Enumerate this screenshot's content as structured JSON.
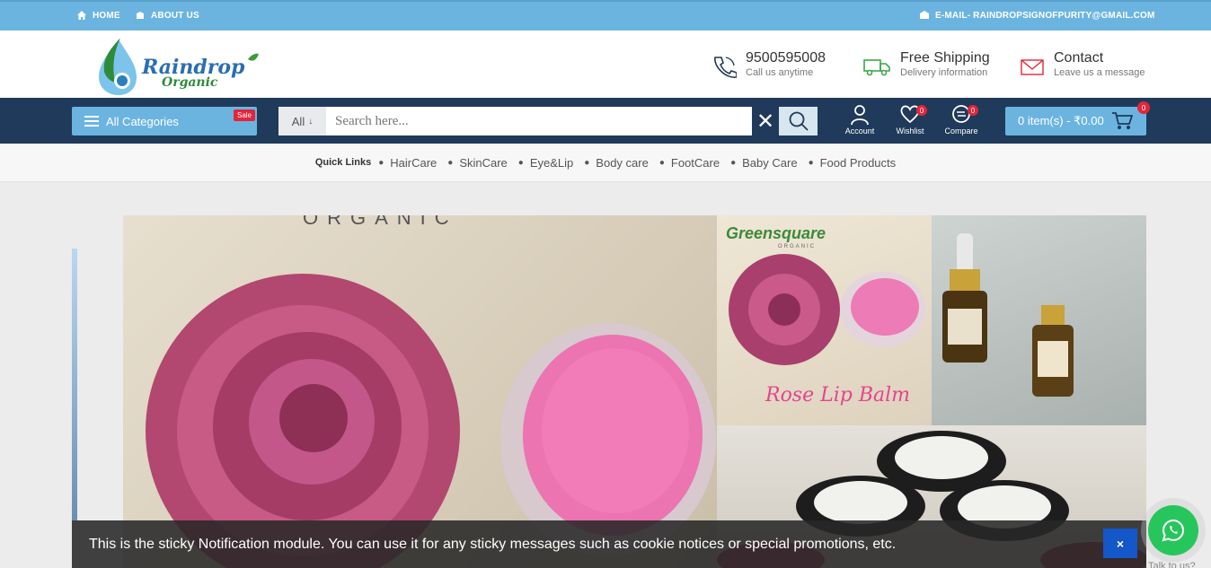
{
  "topbar": {
    "home": "HOME",
    "about": "ABOUT US",
    "email": "E-MAIL- RAINDROPSIGNOFPURITY@GMAIL.COM"
  },
  "header": {
    "logo_text_1": "Raindrop",
    "logo_text_2": "Organic",
    "phone": {
      "main": "9500595008",
      "sub": "Call us anytime"
    },
    "shipping": {
      "main": "Free Shipping",
      "sub": "Delivery information"
    },
    "contact": {
      "main": "Contact",
      "sub": "Leave us a message"
    }
  },
  "nav": {
    "all_categories": "All Categories",
    "sale_badge": "Sale",
    "search_category": "All",
    "search_placeholder": "Search here...",
    "account": "Account",
    "wishlist": "Wishlist",
    "wishlist_count": "0",
    "compare": "Compare",
    "compare_count": "0",
    "cart_label": "0 item(s) - ₹0.00",
    "cart_count": "0"
  },
  "quick_links": {
    "title": "Quick Links",
    "items": [
      "HairCare",
      "SkinCare",
      "Eye&Lip",
      "Body care",
      "FootCare",
      "Baby Care",
      "Food Products"
    ]
  },
  "banner": {
    "top_text": "ORGANIC",
    "brand": "Greensquare",
    "brand_sub": "ORGANIC",
    "product_label": "Rose Lip Balm"
  },
  "notification": {
    "text": "This is the sticky Notification module. You can use it for any sticky messages such as cookie notices or special promotions, etc.",
    "close": "×"
  },
  "whatsapp": {
    "label": "Talk to us?"
  },
  "colors": {
    "accent": "#6cb4e0",
    "navbar": "#1f3a5a",
    "badge": "#e3253a",
    "whatsapp": "#27c65c",
    "close_button": "#1457c8"
  }
}
